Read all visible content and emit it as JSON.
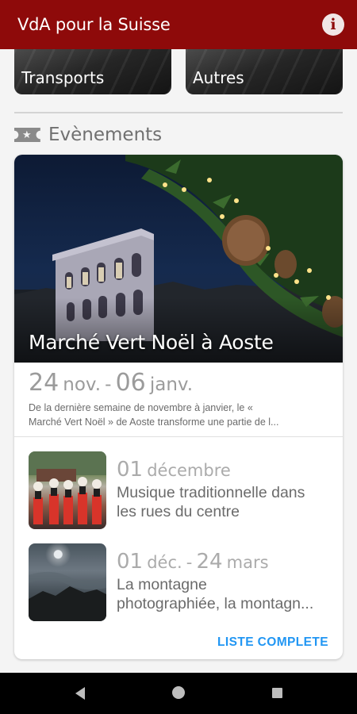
{
  "appbar": {
    "title": "VdA pour la Suisse",
    "info_icon": "info-circle-icon"
  },
  "tiles": [
    {
      "label": "Transports"
    },
    {
      "label": "Autres"
    }
  ],
  "events_section": {
    "icon": "ticket-icon",
    "title": "Evènements",
    "featured": {
      "title": "Marché Vert Noël à Aoste",
      "date_start_day": "24",
      "date_start_month": "nov.",
      "date_separator": "-",
      "date_end_day": "06",
      "date_end_month": "janv.",
      "description_line1": "De la dernière semaine de novembre à janvier, le «",
      "description_line2": "Marché Vert Noël » de Aoste transforme une partie de l..."
    },
    "items": [
      {
        "day": "01",
        "month": "décembre",
        "title_line1": "Musique traditionnelle dans",
        "title_line2": "les rues du centre"
      },
      {
        "day": "01",
        "month": "déc.",
        "separator": "-",
        "end_day": "24",
        "end_month": "mars",
        "title_line1": "La montagne",
        "title_line2": "photographiée, la montagn..."
      }
    ],
    "list_link": "LISTE COMPLETE"
  },
  "colors": {
    "appbar": "#8e0a0a",
    "link": "#2196f3",
    "background": "#f4f4f4"
  },
  "navbar": {
    "back_icon": "back-triangle-icon",
    "home_icon": "home-circle-icon",
    "recents_icon": "recents-square-icon"
  }
}
